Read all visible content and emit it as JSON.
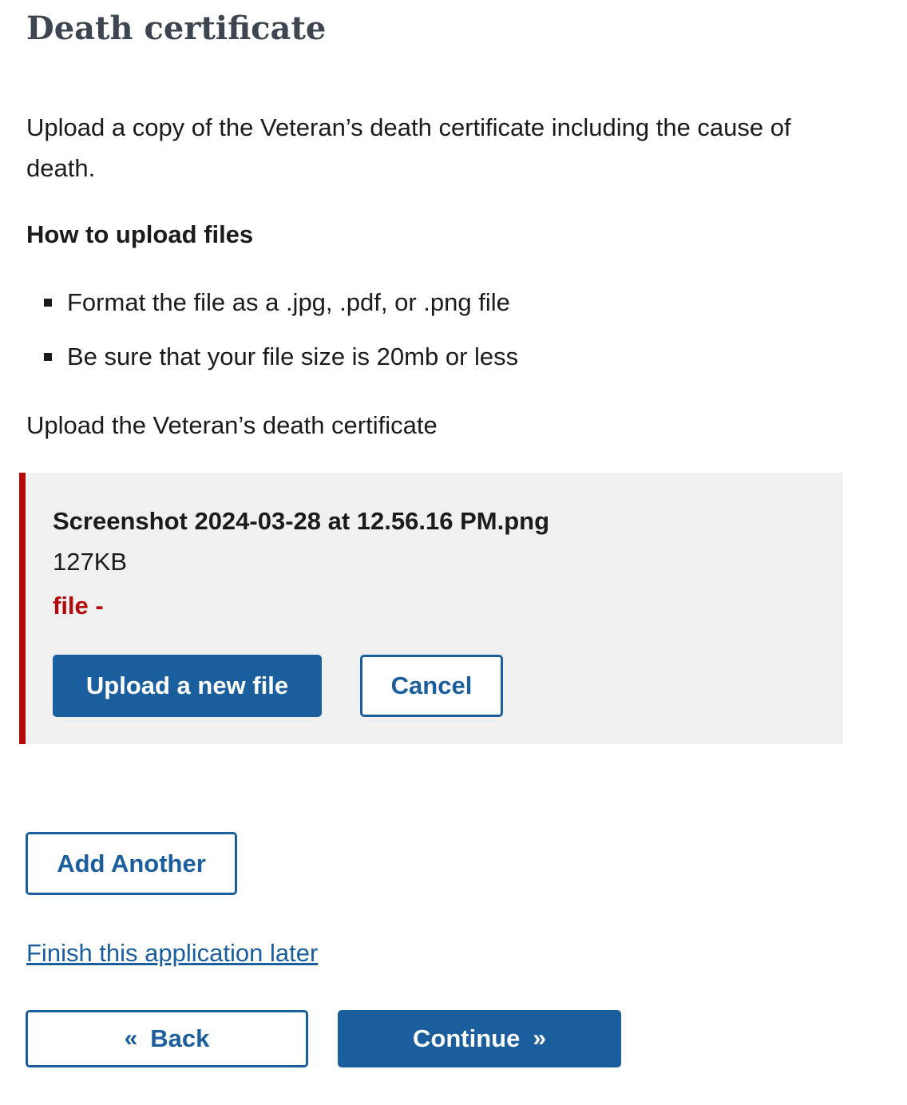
{
  "page": {
    "title": "Death certificate",
    "intro": "Upload a copy of the Veteran’s death certificate including the cause of death.",
    "how_to_heading": "How to upload files",
    "instructions": [
      "Format the file as a .jpg, .pdf, or .png file",
      "Be sure that your file size is 20mb or less"
    ],
    "upload_label": "Upload the Veteran’s death certificate"
  },
  "file_card": {
    "file_name": "Screenshot 2024-03-28 at 12.56.16 PM.png",
    "file_size": "127KB",
    "error_text": "file -",
    "upload_new_label": "Upload a new file",
    "cancel_label": "Cancel"
  },
  "actions": {
    "add_another_label": "Add Another",
    "finish_later_label": "Finish this application later",
    "back_label": "Back",
    "back_icon": "«",
    "continue_label": "Continue",
    "continue_icon": "»"
  },
  "colors": {
    "primary": "#1a5e9e",
    "error": "#b50909",
    "card_background": "#f0f0f0",
    "title": "#3d4551"
  }
}
